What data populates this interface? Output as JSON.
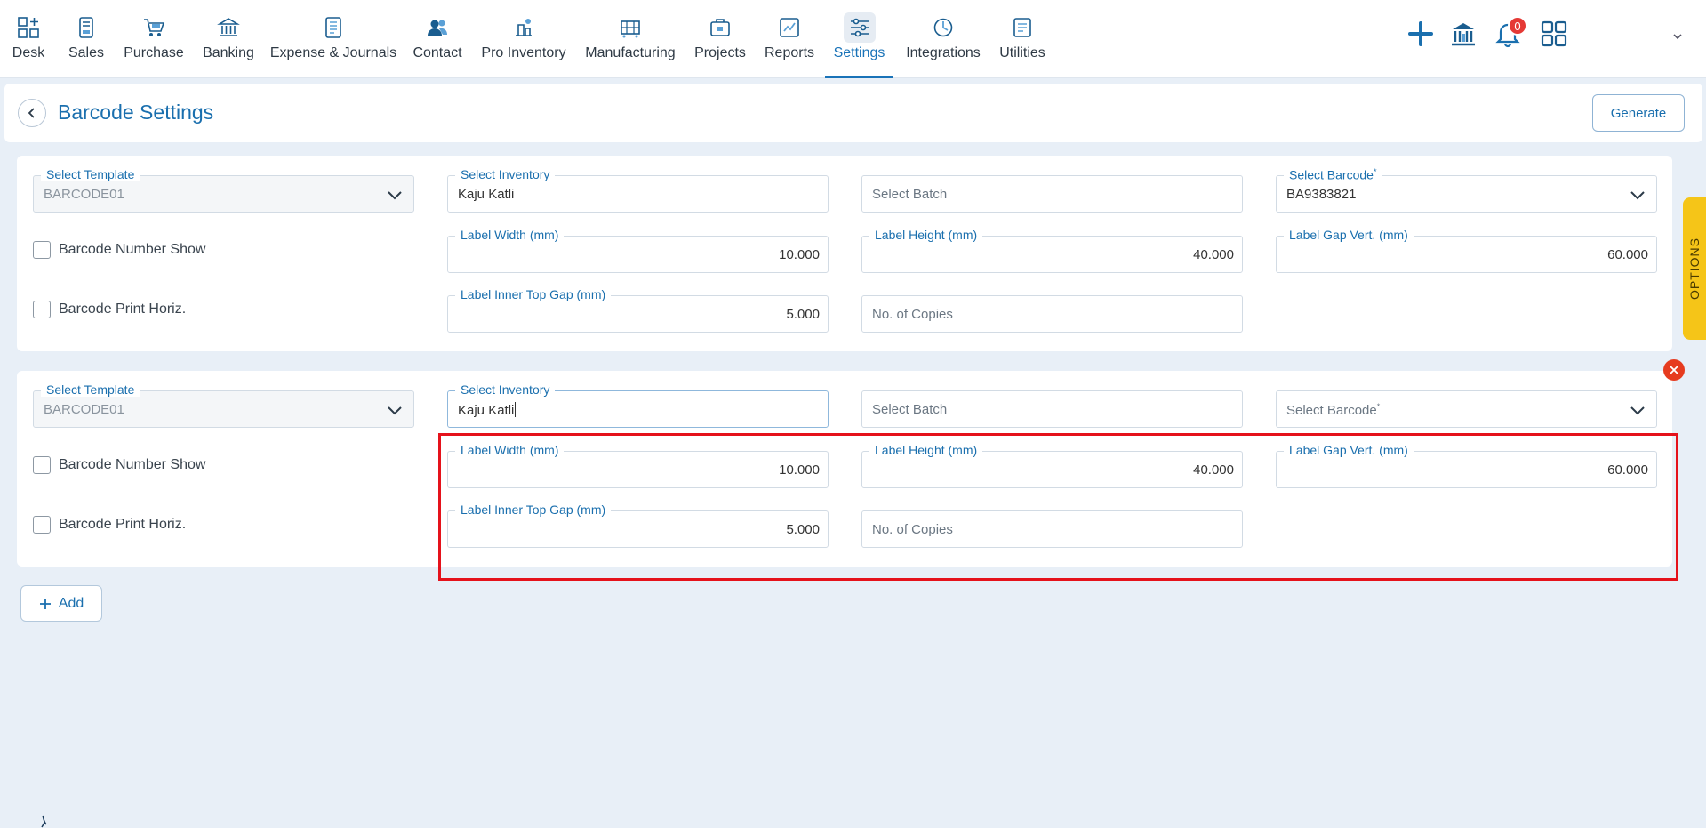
{
  "nav": {
    "items": [
      {
        "label": "Desk",
        "icon": "desk-icon"
      },
      {
        "label": "Sales",
        "icon": "sales-icon"
      },
      {
        "label": "Purchase",
        "icon": "cart-icon"
      },
      {
        "label": "Banking",
        "icon": "bank-icon"
      },
      {
        "label": "Expense & Journals",
        "icon": "journal-icon"
      },
      {
        "label": "Contact",
        "icon": "contact-icon"
      },
      {
        "label": "Pro Inventory",
        "icon": "inventory-icon"
      },
      {
        "label": "Manufacturing",
        "icon": "manufacturing-icon"
      },
      {
        "label": "Projects",
        "icon": "projects-icon"
      },
      {
        "label": "Reports",
        "icon": "reports-icon"
      },
      {
        "label": "Settings",
        "icon": "settings-icon",
        "active": true
      },
      {
        "label": "Integrations",
        "icon": "integrations-icon"
      },
      {
        "label": "Utilities",
        "icon": "utilities-icon"
      }
    ],
    "notification_count": "0"
  },
  "header": {
    "title": "Barcode Settings",
    "generate_label": "Generate"
  },
  "rows": [
    {
      "template_label": "Select Template",
      "template_value": "BARCODE01",
      "inventory_label": "Select Inventory",
      "inventory_value": "Kaju Katli",
      "batch_placeholder": "Select Batch",
      "barcode_label": "Select Barcode",
      "barcode_value": "BA9383821",
      "barcode_number_show": "Barcode Number Show",
      "barcode_print_horiz": "Barcode Print Horiz.",
      "label_width_label": "Label Width (mm)",
      "label_width_value": "10.000",
      "label_height_label": "Label Height (mm)",
      "label_height_value": "40.000",
      "label_gap_label": "Label Gap Vert. (mm)",
      "label_gap_value": "60.000",
      "inner_top_gap_label": "Label Inner Top Gap (mm)",
      "inner_top_gap_value": "5.000",
      "copies_placeholder": "No. of Copies"
    },
    {
      "template_label": "Select Template",
      "template_value": "BARCODE01",
      "inventory_label": "Select Inventory",
      "inventory_value": "Kaju Katli",
      "batch_placeholder": "Select Batch",
      "barcode_placeholder": "Select Barcode",
      "barcode_number_show": "Barcode Number Show",
      "barcode_print_horiz": "Barcode Print Horiz.",
      "label_width_label": "Label Width (mm)",
      "label_width_value": "10.000",
      "label_height_label": "Label Height (mm)",
      "label_height_value": "40.000",
      "label_gap_label": "Label Gap Vert. (mm)",
      "label_gap_value": "60.000",
      "inner_top_gap_label": "Label Inner Top Gap (mm)",
      "inner_top_gap_value": "5.000",
      "copies_placeholder": "No. of Copies"
    }
  ],
  "add_label": "Add",
  "options_label": "OPTIONS",
  "colors": {
    "accent": "#1a6fae",
    "highlight": "#e5121b",
    "options_tab": "#f5c518",
    "remove": "#e63b1f"
  }
}
